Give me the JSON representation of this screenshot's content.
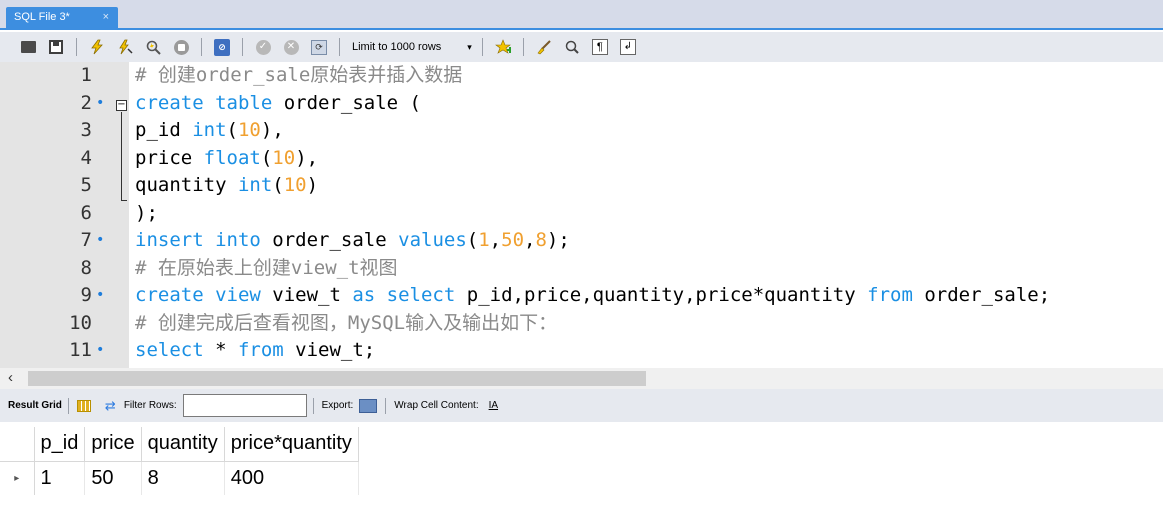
{
  "tab": {
    "title": "SQL File 3*",
    "close": "×"
  },
  "toolbar": {
    "limit_label": "Limit to 1000 rows",
    "limit_arrow": "▾"
  },
  "editor": {
    "lines": [
      {
        "num": "1",
        "dot": "",
        "segments": [
          {
            "t": "# 创建order_sale原始表并插入数据",
            "c": "cm"
          }
        ]
      },
      {
        "num": "2",
        "dot": "•",
        "segments": [
          {
            "t": "create table",
            "c": "kw"
          },
          {
            "t": " order_sale (",
            "c": ""
          }
        ]
      },
      {
        "num": "3",
        "dot": "",
        "segments": [
          {
            "t": "p_id ",
            "c": ""
          },
          {
            "t": "int",
            "c": "kw"
          },
          {
            "t": "(",
            "c": ""
          },
          {
            "t": "10",
            "c": "num"
          },
          {
            "t": "),",
            "c": ""
          }
        ]
      },
      {
        "num": "4",
        "dot": "",
        "segments": [
          {
            "t": "price ",
            "c": ""
          },
          {
            "t": "float",
            "c": "kw"
          },
          {
            "t": "(",
            "c": ""
          },
          {
            "t": "10",
            "c": "num"
          },
          {
            "t": "),",
            "c": ""
          }
        ]
      },
      {
        "num": "5",
        "dot": "",
        "segments": [
          {
            "t": "quantity ",
            "c": ""
          },
          {
            "t": "int",
            "c": "kw"
          },
          {
            "t": "(",
            "c": ""
          },
          {
            "t": "10",
            "c": "num"
          },
          {
            "t": ")",
            "c": ""
          }
        ]
      },
      {
        "num": "6",
        "dot": "",
        "segments": [
          {
            "t": ");",
            "c": ""
          }
        ]
      },
      {
        "num": "7",
        "dot": "•",
        "segments": [
          {
            "t": "insert into",
            "c": "kw"
          },
          {
            "t": " order_sale ",
            "c": ""
          },
          {
            "t": "values",
            "c": "kw"
          },
          {
            "t": "(",
            "c": ""
          },
          {
            "t": "1",
            "c": "num"
          },
          {
            "t": ",",
            "c": ""
          },
          {
            "t": "50",
            "c": "num"
          },
          {
            "t": ",",
            "c": ""
          },
          {
            "t": "8",
            "c": "num"
          },
          {
            "t": ");",
            "c": ""
          }
        ]
      },
      {
        "num": "8",
        "dot": "",
        "segments": [
          {
            "t": "# 在原始表上创建view_t视图",
            "c": "cm"
          }
        ]
      },
      {
        "num": "9",
        "dot": "•",
        "segments": [
          {
            "t": "create view",
            "c": "kw"
          },
          {
            "t": " view_t ",
            "c": ""
          },
          {
            "t": "as select",
            "c": "kw"
          },
          {
            "t": " p_id,price,quantity,price*quantity ",
            "c": ""
          },
          {
            "t": "from",
            "c": "kw"
          },
          {
            "t": " order_sale;",
            "c": ""
          }
        ]
      },
      {
        "num": "10",
        "dot": "",
        "segments": [
          {
            "t": "# 创建完成后查看视图，MySQL输入及输出如下：",
            "c": "cm"
          }
        ]
      },
      {
        "num": "11",
        "dot": "•",
        "segments": [
          {
            "t": "select",
            "c": "kw"
          },
          {
            "t": " * ",
            "c": ""
          },
          {
            "t": "from",
            "c": "kw"
          },
          {
            "t": " view_t;",
            "c": ""
          }
        ]
      }
    ]
  },
  "result_toolbar": {
    "result_grid_label": "Result Grid",
    "filter_rows_label": "Filter Rows:",
    "filter_value": "",
    "export_label": "Export:",
    "wrap_label": "Wrap Cell Content:",
    "wrap_icon": "IA"
  },
  "result_grid": {
    "columns": [
      "p_id",
      "price",
      "quantity",
      "price*quantity"
    ],
    "rows": [
      [
        "1",
        "50",
        "8",
        "400"
      ]
    ],
    "row_marker": "▸"
  }
}
